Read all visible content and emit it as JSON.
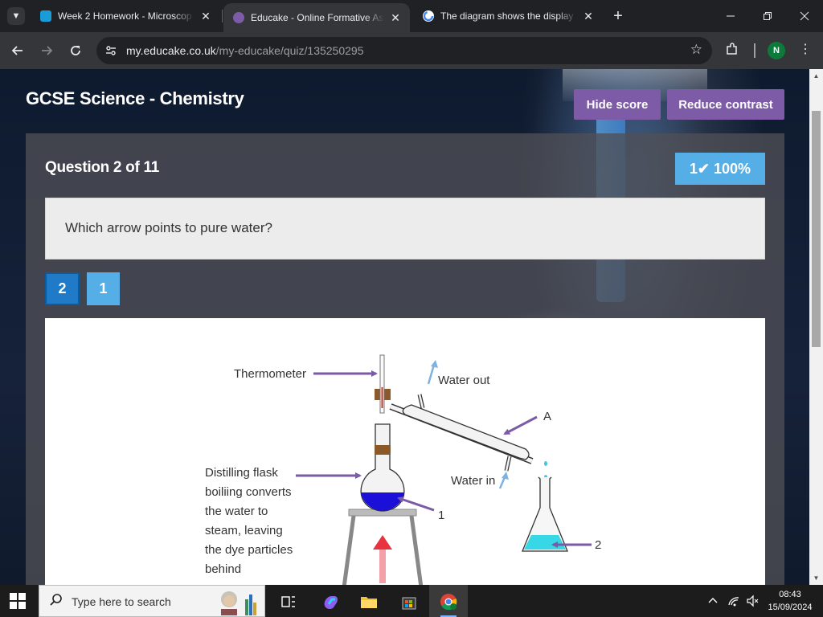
{
  "browser": {
    "tabs": [
      {
        "title": "Week 2 Homework - Microscop",
        "favicon_color": "#1a9cd8",
        "active": false
      },
      {
        "title": "Educake - Online Formative Ass",
        "favicon_color": "#7d5ba6",
        "active": true
      },
      {
        "title": "The diagram shows the display",
        "favicon_color": "#ffffff",
        "active": false
      }
    ],
    "close_glyph": "✕",
    "new_tab_glyph": "+",
    "url_domain": "my.educake.co.uk",
    "url_path": "/my-educake/quiz/135250295",
    "profile_initial": "N"
  },
  "page": {
    "course_title": "GCSE Science - Chemistry",
    "hide_score_label": "Hide score",
    "reduce_contrast_label": "Reduce contrast",
    "question_count": "Question 2 of 11",
    "score_text": "1✔ 100%",
    "question": "Which arrow points to pure water?",
    "answers": [
      {
        "label": "2",
        "selected": true
      },
      {
        "label": "1",
        "selected": false
      }
    ]
  },
  "diagram": {
    "thermometer": "Thermometer",
    "water_out": "Water out",
    "water_in": "Water in",
    "label_a": "A",
    "label_1": "1",
    "label_2": "2",
    "flask_lines": [
      "Distilling flask",
      "boiliing converts",
      "the water to",
      "steam, leaving",
      "the dye particles",
      "behind"
    ]
  },
  "taskbar": {
    "search_placeholder": "Type here to search",
    "time": "08:43",
    "date": "15/09/2024"
  },
  "colors": {
    "accent_purple": "#7d5ba6",
    "score_blue": "#55aee6",
    "selected_blue": "#1f7ac8",
    "arrow_purple": "#7b5aa6"
  }
}
